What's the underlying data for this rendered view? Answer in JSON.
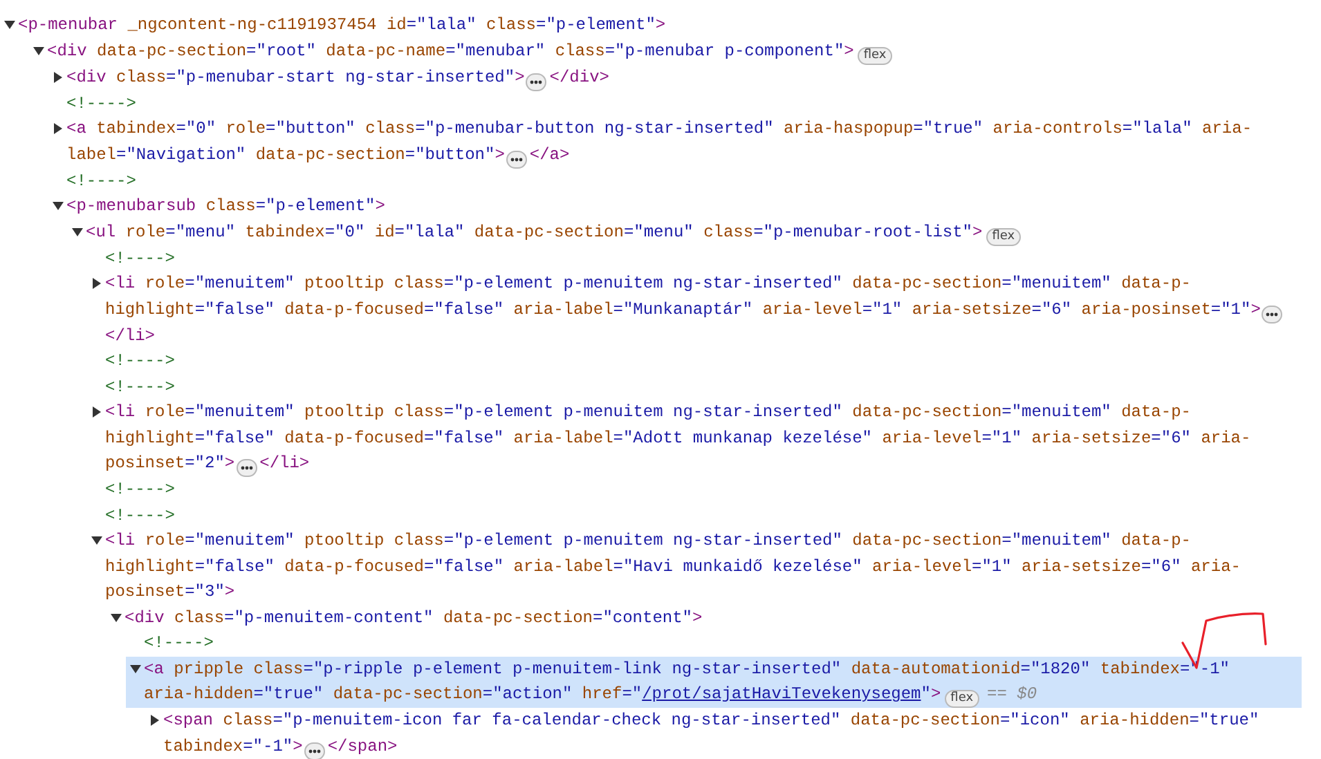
{
  "dom_tree": [
    {
      "kind": "element",
      "expanded": true,
      "selected": false,
      "lines": [
        [
          {
            "kind": "tag",
            "text": "<p-menubar"
          },
          {
            "kind": "name",
            "text": "_ngcontent-ng-c1191937454"
          },
          {
            "kind": "name",
            "text": "id"
          },
          {
            "kind": "value",
            "text": "=\"lala\""
          },
          {
            "kind": "name",
            "text": "class"
          },
          {
            "kind": "value",
            "text": "=\"p-element\""
          },
          {
            "kind": "tag",
            "text": ">"
          }
        ]
      ],
      "children": [
        {
          "kind": "element",
          "expanded": true,
          "selected": false,
          "lines": [
            [
              {
                "kind": "tag",
                "text": "<div"
              },
              {
                "kind": "name",
                "text": "data-pc-section"
              },
              {
                "kind": "value",
                "text": "=\"root\""
              },
              {
                "kind": "name",
                "text": "data-pc-name"
              },
              {
                "kind": "value",
                "text": "=\"menubar\""
              },
              {
                "kind": "name",
                "text": "class"
              },
              {
                "kind": "value",
                "text": "=\"p-menubar p-component\""
              },
              {
                "kind": "tag",
                "text": ">"
              }
            ]
          ],
          "badge": "flex",
          "children": [
            {
              "kind": "element",
              "expanded": false,
              "selected": false,
              "lines": [
                [
                  {
                    "kind": "tag",
                    "text": "<div"
                  },
                  {
                    "kind": "name",
                    "text": "class"
                  },
                  {
                    "kind": "value",
                    "text": "=\"p-menubar-start ng-star-inserted\""
                  },
                  {
                    "kind": "tag",
                    "text": ">"
                  }
                ]
              ],
              "close": "</div>"
            },
            {
              "kind": "comment",
              "text": "<!---->"
            },
            {
              "kind": "element",
              "expanded": false,
              "selected": false,
              "lines": [
                [
                  {
                    "kind": "tag",
                    "text": "<a"
                  },
                  {
                    "kind": "name",
                    "text": "tabindex"
                  },
                  {
                    "kind": "value",
                    "text": "=\"0\""
                  },
                  {
                    "kind": "name",
                    "text": "role"
                  },
                  {
                    "kind": "value",
                    "text": "=\"button\""
                  },
                  {
                    "kind": "name",
                    "text": "class"
                  },
                  {
                    "kind": "value",
                    "text": "=\"p-menubar-button ng-star-inserted\""
                  },
                  {
                    "kind": "name",
                    "text": "aria-haspopup"
                  },
                  {
                    "kind": "value",
                    "text": "=\"true\""
                  },
                  {
                    "kind": "name",
                    "text": "aria-controls"
                  },
                  {
                    "kind": "value",
                    "text": "=\"lala\""
                  },
                  {
                    "kind": "name",
                    "text": "aria-"
                  }
                ],
                [
                  {
                    "kind": "name",
                    "text": "label"
                  },
                  {
                    "kind": "value",
                    "text": "=\"Navigation\""
                  },
                  {
                    "kind": "name",
                    "text": "data-pc-section"
                  },
                  {
                    "kind": "value",
                    "text": "=\"button\""
                  },
                  {
                    "kind": "tag",
                    "text": ">"
                  }
                ]
              ],
              "close": "</a>"
            },
            {
              "kind": "comment",
              "text": "<!---->"
            },
            {
              "kind": "element",
              "expanded": true,
              "selected": false,
              "lines": [
                [
                  {
                    "kind": "tag",
                    "text": "<p-menubarsub"
                  },
                  {
                    "kind": "name",
                    "text": "class"
                  },
                  {
                    "kind": "value",
                    "text": "=\"p-element\""
                  },
                  {
                    "kind": "tag",
                    "text": ">"
                  }
                ]
              ],
              "children": [
                {
                  "kind": "element",
                  "expanded": true,
                  "selected": false,
                  "lines": [
                    [
                      {
                        "kind": "tag",
                        "text": "<ul"
                      },
                      {
                        "kind": "name",
                        "text": "role"
                      },
                      {
                        "kind": "value",
                        "text": "=\"menu\""
                      },
                      {
                        "kind": "name",
                        "text": "tabindex"
                      },
                      {
                        "kind": "value",
                        "text": "=\"0\""
                      },
                      {
                        "kind": "name",
                        "text": "id"
                      },
                      {
                        "kind": "value",
                        "text": "=\"lala\""
                      },
                      {
                        "kind": "name",
                        "text": "data-pc-section"
                      },
                      {
                        "kind": "value",
                        "text": "=\"menu\""
                      },
                      {
                        "kind": "name",
                        "text": "class"
                      },
                      {
                        "kind": "value",
                        "text": "=\"p-menubar-root-list\""
                      },
                      {
                        "kind": "tag",
                        "text": ">"
                      }
                    ]
                  ],
                  "badge": "flex",
                  "children": [
                    {
                      "kind": "comment",
                      "text": "<!---->"
                    },
                    {
                      "kind": "element",
                      "expanded": false,
                      "selected": false,
                      "lines": [
                        [
                          {
                            "kind": "tag",
                            "text": "<li"
                          },
                          {
                            "kind": "name",
                            "text": "role"
                          },
                          {
                            "kind": "value",
                            "text": "=\"menuitem\""
                          },
                          {
                            "kind": "name",
                            "text": "ptooltip"
                          },
                          {
                            "kind": "name",
                            "text": "class"
                          },
                          {
                            "kind": "value",
                            "text": "=\"p-element p-menuitem ng-star-inserted\""
                          },
                          {
                            "kind": "name",
                            "text": "data-pc-section"
                          },
                          {
                            "kind": "value",
                            "text": "=\"menuitem\""
                          },
                          {
                            "kind": "name",
                            "text": "data-p-"
                          }
                        ],
                        [
                          {
                            "kind": "name",
                            "text": "highlight"
                          },
                          {
                            "kind": "value",
                            "text": "=\"false\""
                          },
                          {
                            "kind": "name",
                            "text": "data-p-focused"
                          },
                          {
                            "kind": "value",
                            "text": "=\"false\""
                          },
                          {
                            "kind": "name",
                            "text": "aria-label"
                          },
                          {
                            "kind": "value",
                            "text": "=\"Munkanaptár\""
                          },
                          {
                            "kind": "name",
                            "text": "aria-level"
                          },
                          {
                            "kind": "value",
                            "text": "=\"1\""
                          },
                          {
                            "kind": "name",
                            "text": "aria-setsize"
                          },
                          {
                            "kind": "value",
                            "text": "=\"6\""
                          },
                          {
                            "kind": "name",
                            "text": "aria-posinset"
                          },
                          {
                            "kind": "value",
                            "text": "=\"1\""
                          },
                          {
                            "kind": "tag",
                            "text": ">"
                          }
                        ]
                      ],
                      "close": "</li>"
                    },
                    {
                      "kind": "comment",
                      "text": "<!---->"
                    },
                    {
                      "kind": "comment",
                      "text": "<!---->"
                    },
                    {
                      "kind": "element",
                      "expanded": false,
                      "selected": false,
                      "lines": [
                        [
                          {
                            "kind": "tag",
                            "text": "<li"
                          },
                          {
                            "kind": "name",
                            "text": "role"
                          },
                          {
                            "kind": "value",
                            "text": "=\"menuitem\""
                          },
                          {
                            "kind": "name",
                            "text": "ptooltip"
                          },
                          {
                            "kind": "name",
                            "text": "class"
                          },
                          {
                            "kind": "value",
                            "text": "=\"p-element p-menuitem ng-star-inserted\""
                          },
                          {
                            "kind": "name",
                            "text": "data-pc-section"
                          },
                          {
                            "kind": "value",
                            "text": "=\"menuitem\""
                          },
                          {
                            "kind": "name",
                            "text": "data-p-"
                          }
                        ],
                        [
                          {
                            "kind": "name",
                            "text": "highlight"
                          },
                          {
                            "kind": "value",
                            "text": "=\"false\""
                          },
                          {
                            "kind": "name",
                            "text": "data-p-focused"
                          },
                          {
                            "kind": "value",
                            "text": "=\"false\""
                          },
                          {
                            "kind": "name",
                            "text": "aria-label"
                          },
                          {
                            "kind": "value",
                            "text": "=\"Adott munkanap kezelése\""
                          },
                          {
                            "kind": "name",
                            "text": "aria-level"
                          },
                          {
                            "kind": "value",
                            "text": "=\"1\""
                          },
                          {
                            "kind": "name",
                            "text": "aria-setsize"
                          },
                          {
                            "kind": "value",
                            "text": "=\"6\""
                          },
                          {
                            "kind": "name",
                            "text": "aria-"
                          }
                        ],
                        [
                          {
                            "kind": "name",
                            "text": "posinset"
                          },
                          {
                            "kind": "value",
                            "text": "=\"2\""
                          },
                          {
                            "kind": "tag",
                            "text": ">"
                          }
                        ]
                      ],
                      "close": "</li>"
                    },
                    {
                      "kind": "comment",
                      "text": "<!---->"
                    },
                    {
                      "kind": "comment",
                      "text": "<!---->"
                    },
                    {
                      "kind": "element",
                      "expanded": true,
                      "selected": false,
                      "lines": [
                        [
                          {
                            "kind": "tag",
                            "text": "<li"
                          },
                          {
                            "kind": "name",
                            "text": "role"
                          },
                          {
                            "kind": "value",
                            "text": "=\"menuitem\""
                          },
                          {
                            "kind": "name",
                            "text": "ptooltip"
                          },
                          {
                            "kind": "name",
                            "text": "class"
                          },
                          {
                            "kind": "value",
                            "text": "=\"p-element p-menuitem ng-star-inserted\""
                          },
                          {
                            "kind": "name",
                            "text": "data-pc-section"
                          },
                          {
                            "kind": "value",
                            "text": "=\"menuitem\""
                          },
                          {
                            "kind": "name",
                            "text": "data-p-"
                          }
                        ],
                        [
                          {
                            "kind": "name",
                            "text": "highlight"
                          },
                          {
                            "kind": "value",
                            "text": "=\"false\""
                          },
                          {
                            "kind": "name",
                            "text": "data-p-focused"
                          },
                          {
                            "kind": "value",
                            "text": "=\"false\""
                          },
                          {
                            "kind": "name",
                            "text": "aria-label"
                          },
                          {
                            "kind": "value",
                            "text": "=\"Havi munkaidő kezelése\""
                          },
                          {
                            "kind": "name",
                            "text": "aria-level"
                          },
                          {
                            "kind": "value",
                            "text": "=\"1\""
                          },
                          {
                            "kind": "name",
                            "text": "aria-setsize"
                          },
                          {
                            "kind": "value",
                            "text": "=\"6\""
                          },
                          {
                            "kind": "name",
                            "text": "aria-"
                          }
                        ],
                        [
                          {
                            "kind": "name",
                            "text": "posinset"
                          },
                          {
                            "kind": "value",
                            "text": "=\"3\""
                          },
                          {
                            "kind": "tag",
                            "text": ">"
                          }
                        ]
                      ],
                      "children": [
                        {
                          "kind": "element",
                          "expanded": true,
                          "selected": false,
                          "lines": [
                            [
                              {
                                "kind": "tag",
                                "text": "<div"
                              },
                              {
                                "kind": "name",
                                "text": "class"
                              },
                              {
                                "kind": "value",
                                "text": "=\"p-menuitem-content\""
                              },
                              {
                                "kind": "name",
                                "text": "data-pc-section"
                              },
                              {
                                "kind": "value",
                                "text": "=\"content\""
                              },
                              {
                                "kind": "tag",
                                "text": ">"
                              }
                            ]
                          ],
                          "children": [
                            {
                              "kind": "comment",
                              "text": "<!---->"
                            },
                            {
                              "kind": "element",
                              "expanded": true,
                              "selected": true,
                              "lines": [
                                [
                                  {
                                    "kind": "tag",
                                    "text": "<a"
                                  },
                                  {
                                    "kind": "name",
                                    "text": "pripple"
                                  },
                                  {
                                    "kind": "name",
                                    "text": "class"
                                  },
                                  {
                                    "kind": "value",
                                    "text": "=\"p-ripple p-element p-menuitem-link ng-star-inserted\""
                                  },
                                  {
                                    "kind": "name",
                                    "text": "data-automationid"
                                  },
                                  {
                                    "kind": "value",
                                    "text": "=\"1820\""
                                  },
                                  {
                                    "kind": "name",
                                    "text": "tabindex"
                                  },
                                  {
                                    "kind": "value",
                                    "text": "=\"-1\"",
                                    "annotation": {
                                      "kind": "checkmark"
                                    }
                                  }
                                ],
                                [
                                  {
                                    "kind": "name",
                                    "text": "aria-hidden"
                                  },
                                  {
                                    "kind": "value",
                                    "text": "=\"true\""
                                  },
                                  {
                                    "kind": "name",
                                    "text": "data-pc-section"
                                  },
                                  {
                                    "kind": "value",
                                    "text": "=\"action\""
                                  },
                                  {
                                    "kind": "name",
                                    "text": "href"
                                  },
                                  {
                                    "kind": "value",
                                    "text": "=\""
                                  },
                                  {
                                    "kind": "link",
                                    "text": "/prot/sajatHaviTevekenysegem"
                                  },
                                  {
                                    "kind": "value",
                                    "text": "\""
                                  },
                                  {
                                    "kind": "tag",
                                    "text": ">"
                                  }
                                ]
                              ],
                              "badge": "flex",
                              "console_ref": "== $0",
                              "children": [
                                {
                                  "kind": "element",
                                  "expanded": false,
                                  "selected": false,
                                  "lines": [
                                    [
                                      {
                                        "kind": "tag",
                                        "text": "<span"
                                      },
                                      {
                                        "kind": "name",
                                        "text": "class"
                                      },
                                      {
                                        "kind": "value",
                                        "text": "=\"p-menuitem-icon far fa-calendar-check ng-star-inserted\""
                                      },
                                      {
                                        "kind": "name",
                                        "text": "data-pc-section"
                                      },
                                      {
                                        "kind": "value",
                                        "text": "=\"icon\""
                                      },
                                      {
                                        "kind": "name",
                                        "text": "aria-hidden"
                                      },
                                      {
                                        "kind": "value",
                                        "text": "=\"true\""
                                      }
                                    ],
                                    [
                                      {
                                        "kind": "name",
                                        "text": "tabindex"
                                      },
                                      {
                                        "kind": "value",
                                        "text": "=\"-1\""
                                      },
                                      {
                                        "kind": "tag",
                                        "text": ">"
                                      }
                                    ]
                                  ],
                                  "close": "</span>"
                                }
                              ]
                            }
                          ]
                        }
                      ]
                    }
                  ]
                }
              ]
            }
          ]
        }
      ]
    }
  ]
}
